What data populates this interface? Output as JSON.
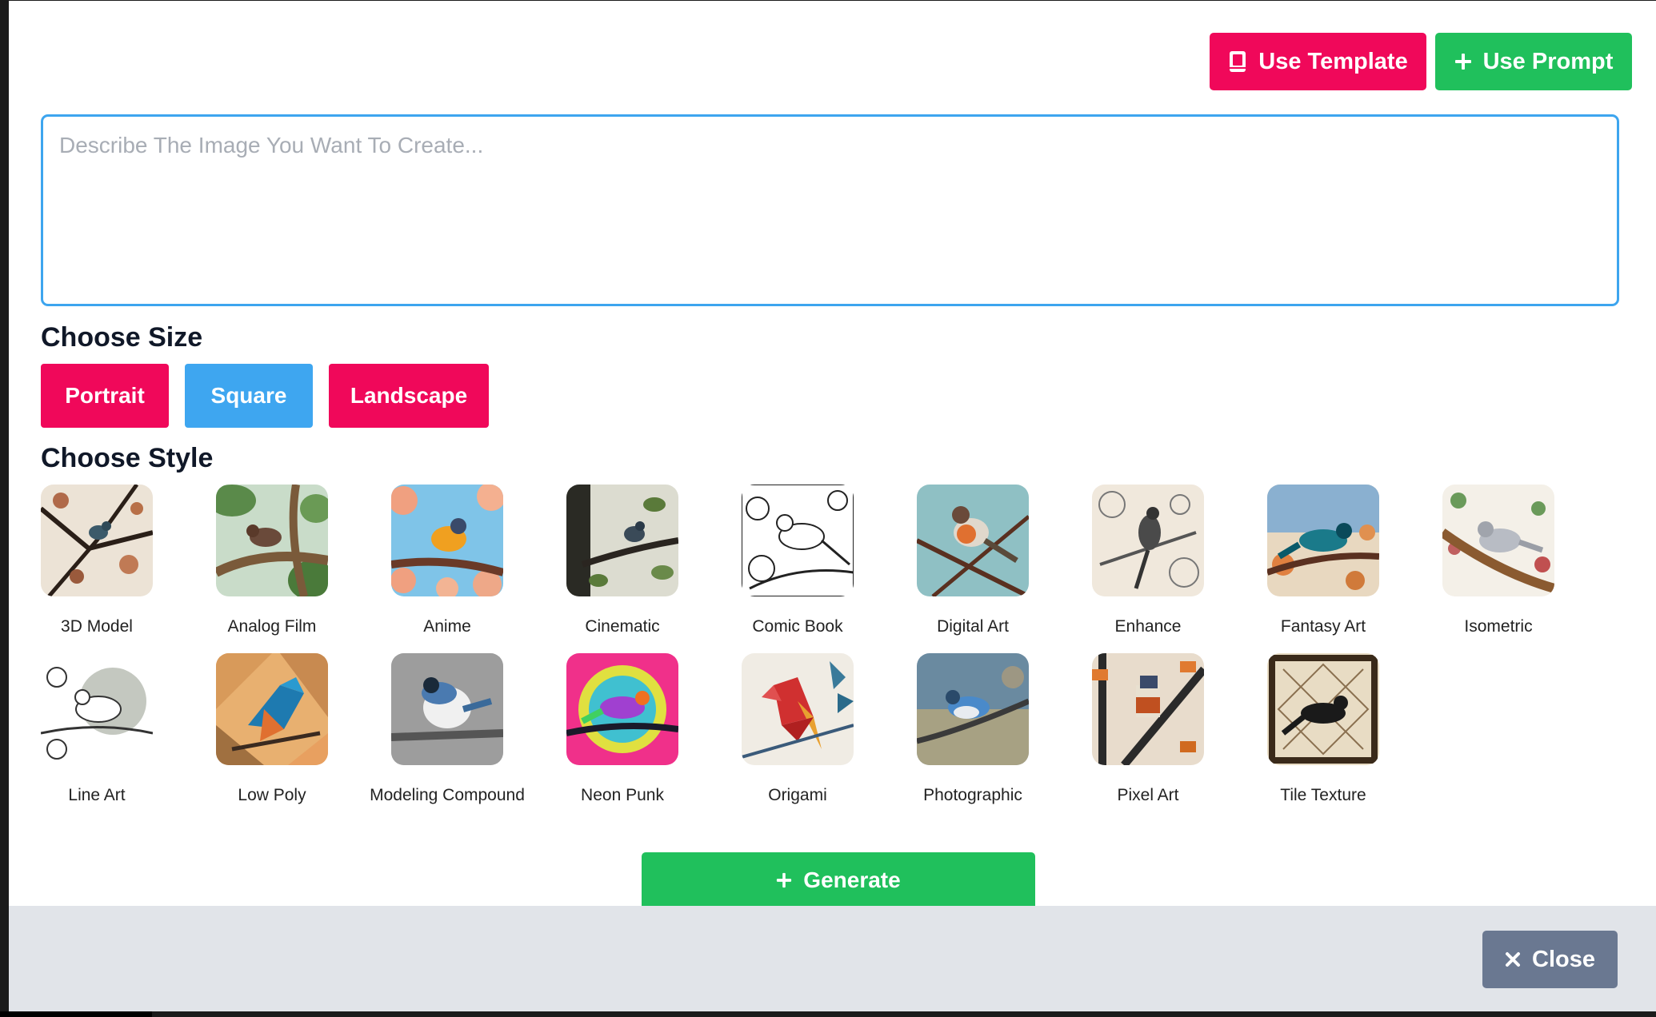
{
  "toolbar": {
    "template_label": "Use Template",
    "prompt_label": "Use Prompt"
  },
  "prompt": {
    "placeholder": "Describe The Image You Want To Create...",
    "value": ""
  },
  "size": {
    "title": "Choose Size",
    "options": [
      "Portrait",
      "Square",
      "Landscape"
    ],
    "selected": "Square"
  },
  "style": {
    "title": "Choose Style",
    "items": [
      {
        "label": "3D Model"
      },
      {
        "label": "Analog Film"
      },
      {
        "label": "Anime"
      },
      {
        "label": "Cinematic"
      },
      {
        "label": "Comic Book"
      },
      {
        "label": "Digital Art"
      },
      {
        "label": "Enhance"
      },
      {
        "label": "Fantasy Art"
      },
      {
        "label": "Isometric"
      },
      {
        "label": "Line Art"
      },
      {
        "label": "Low Poly"
      },
      {
        "label": "Modeling Compound"
      },
      {
        "label": "Neon Punk"
      },
      {
        "label": "Origami"
      },
      {
        "label": "Photographic"
      },
      {
        "label": "Pixel Art"
      },
      {
        "label": "Tile Texture"
      }
    ]
  },
  "generate_label": "Generate",
  "close_label": "Close",
  "colors": {
    "pink": "#f0085a",
    "green": "#20c05c",
    "blue": "#3ea6f0",
    "slate": "#6a7891"
  }
}
